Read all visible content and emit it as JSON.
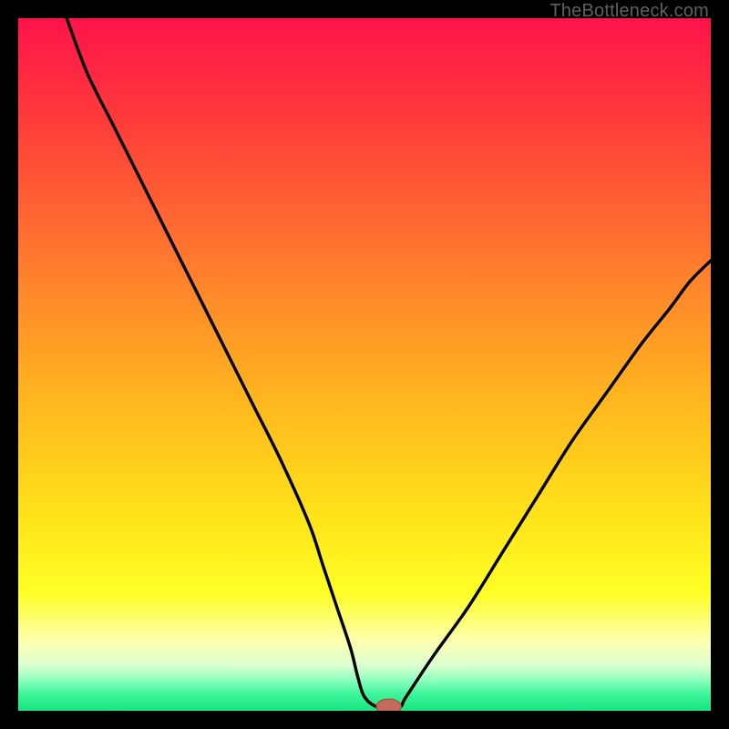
{
  "watermark": "TheBottleneck.com",
  "colors": {
    "frame": "#000000",
    "gradient_stops": [
      {
        "offset": 0.0,
        "color": "#ff134b"
      },
      {
        "offset": 0.15,
        "color": "#ff3c3a"
      },
      {
        "offset": 0.35,
        "color": "#ff7a2e"
      },
      {
        "offset": 0.55,
        "color": "#ffb61f"
      },
      {
        "offset": 0.72,
        "color": "#ffe31a"
      },
      {
        "offset": 0.83,
        "color": "#ffff26"
      },
      {
        "offset": 0.9,
        "color": "#fdffb0"
      },
      {
        "offset": 0.935,
        "color": "#d9ffd0"
      },
      {
        "offset": 0.955,
        "color": "#90ffc0"
      },
      {
        "offset": 0.975,
        "color": "#40f59b"
      },
      {
        "offset": 1.0,
        "color": "#18e482"
      }
    ],
    "curve": "#000000",
    "marker_fill": "#c56a5c",
    "marker_stroke": "#9e4c3f"
  },
  "chart_data": {
    "type": "line",
    "title": "",
    "xlabel": "",
    "ylabel": "",
    "xlim": [
      0,
      100
    ],
    "ylim": [
      0,
      100
    ],
    "grid": false,
    "series": [
      {
        "name": "bottleneck-curve",
        "x": [
          7,
          10,
          14,
          18,
          22,
          26,
          30,
          34,
          38,
          42,
          44,
          46,
          48,
          49,
          50,
          52,
          55,
          56,
          60,
          65,
          70,
          75,
          80,
          85,
          90,
          94,
          97,
          100
        ],
        "y": [
          100,
          92,
          84,
          76,
          68,
          60,
          52,
          44,
          36,
          27,
          21,
          15,
          9,
          5,
          2,
          0.5,
          0.5,
          2,
          8,
          15,
          23,
          31,
          39,
          46,
          53,
          58,
          62,
          65
        ]
      }
    ],
    "marker": {
      "x": 53.5,
      "y": 0.6,
      "rx": 1.8,
      "ry": 1.1
    },
    "annotations": []
  }
}
